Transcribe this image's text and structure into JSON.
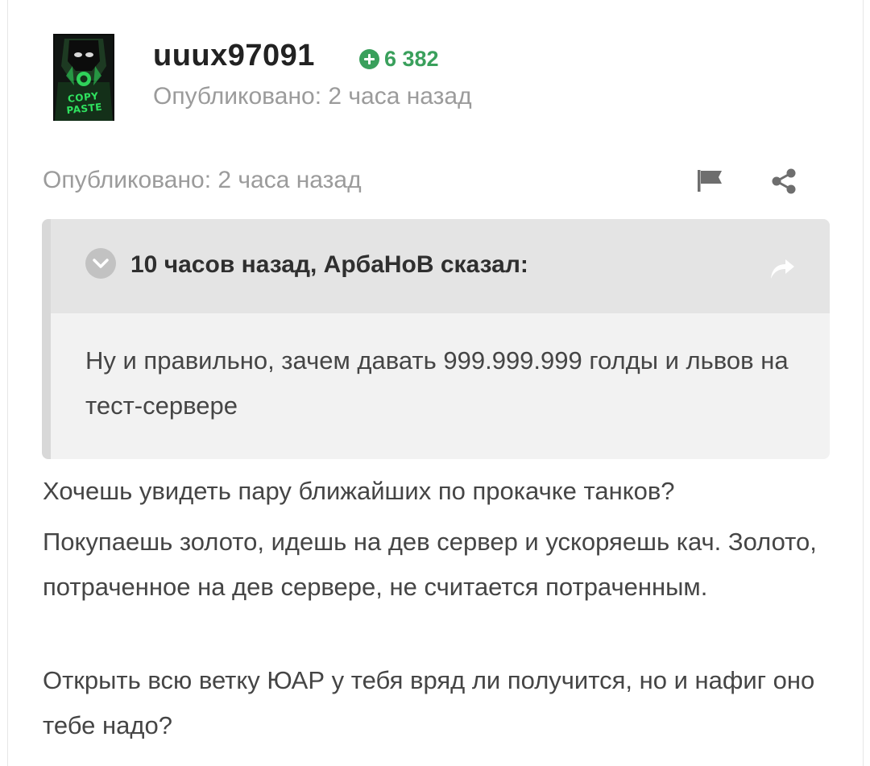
{
  "author": {
    "name": "uuux97091",
    "reputation": "6 382",
    "avatar_text": "COPY PASTE",
    "published": "Опубликовано: 2 часа назад"
  },
  "post": {
    "published": "Опубликовано: 2 часа назад",
    "actions": [
      "flag-icon",
      "share-icon"
    ],
    "quote": {
      "citation": "10 часов назад, АрбаНоВ сказал:",
      "text": "Ну и правильно, зачем давать 999.999.999 голды и львов на тест-сервере"
    },
    "paragraphs": [
      "Хочешь увидеть пару ближайших по прокачке танков?",
      "Покупаешь золото, идешь на дев сервер и ускоряешь кач. Золото, потраченное на дев сервере, не считается потраченным.",
      "Открыть всю ветку ЮАР у тебя вряд ли получится, но и нафиг оно тебе надо?"
    ]
  },
  "colors": {
    "reputation": "#3aa05c",
    "muted_text": "#9b9b9b",
    "quote_background": "#f2f2f2",
    "quote_header": "#e4e4e4"
  }
}
